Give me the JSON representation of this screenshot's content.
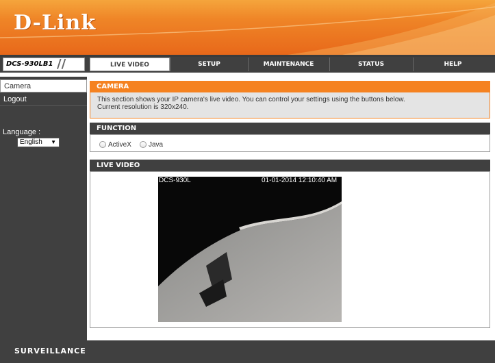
{
  "brand": {
    "logo": "D-Link",
    "model": "DCS-930LB1"
  },
  "nav": {
    "tabs": [
      {
        "label": "LIVE VIDEO",
        "active": true
      },
      {
        "label": "SETUP",
        "active": false
      },
      {
        "label": "MAINTENANCE",
        "active": false
      },
      {
        "label": "STATUS",
        "active": false
      },
      {
        "label": "HELP",
        "active": false
      }
    ]
  },
  "sidebar": {
    "items": [
      {
        "label": "Camera",
        "active": true
      },
      {
        "label": "Logout",
        "active": false
      }
    ],
    "language_label": "Language :",
    "language_selected": "English"
  },
  "camera_panel": {
    "title": "CAMERA",
    "description": "This section shows your IP camera's live video. You can control your settings using the buttons below.",
    "resolution": "Current resolution is 320x240."
  },
  "function_panel": {
    "title": "FUNCTION",
    "options": [
      "ActiveX",
      "Java"
    ]
  },
  "live_video_panel": {
    "title": "LIVE VIDEO",
    "overlay_name": "DCS-930L",
    "overlay_timestamp": "01-01-2014 12:10:40 AM"
  },
  "footer": {
    "label": "SURVEILLANCE"
  },
  "colors": {
    "accent_orange": "#f58220",
    "dark_gray": "#404040",
    "intro_bg": "#e4e4e4"
  }
}
